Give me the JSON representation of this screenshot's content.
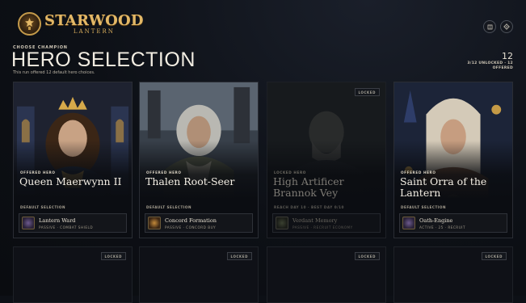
{
  "brand": {
    "name": "STARWOOD",
    "sub": "LANTERN"
  },
  "top_icons": [
    "book-icon",
    "gear-icon"
  ],
  "header": {
    "eyebrow": "CHOOSE CHAMPION",
    "title": "HERO SELECTION",
    "subtitle": "This run offered 12 default hero choices.",
    "count": "12",
    "unlocked_text": "3/12 UNLOCKED · 12 OFFERED"
  },
  "heroes": [
    {
      "status": "OFFERED HERO",
      "name": "Queen Maerwynn II",
      "meta": "DEFAULT SELECTION",
      "ability": "Lantern Ward",
      "ability_meta": "PASSIVE · COMBAT SHIELD",
      "locked": false
    },
    {
      "status": "OFFERED HERO",
      "name": "Thalen Root-Seer",
      "meta": "DEFAULT SELECTION",
      "ability": "Concord Formation",
      "ability_meta": "PASSIVE · CONCORD BUY",
      "locked": false
    },
    {
      "status": "LOCKED HERO",
      "name": "High Artificer Brannok Vey",
      "meta": "REACH DAY 10 · BEST DAY 0/10",
      "ability": "Verdant Memory",
      "ability_meta": "PASSIVE · RECRUIT ECONOMY",
      "locked": true,
      "lock_label": "LOCKED"
    },
    {
      "status": "OFFERED HERO",
      "name": "Saint Orra of the Lantern",
      "meta": "DEFAULT SELECTION",
      "ability": "Oath-Engine",
      "ability_meta": "ACTIVE · 25 · RECRUIT",
      "locked": false
    }
  ],
  "row2": [
    {
      "lock_label": "LOCKED"
    },
    {
      "lock_label": "LOCKED"
    },
    {
      "lock_label": "LOCKED"
    },
    {
      "lock_label": "LOCKED"
    }
  ]
}
